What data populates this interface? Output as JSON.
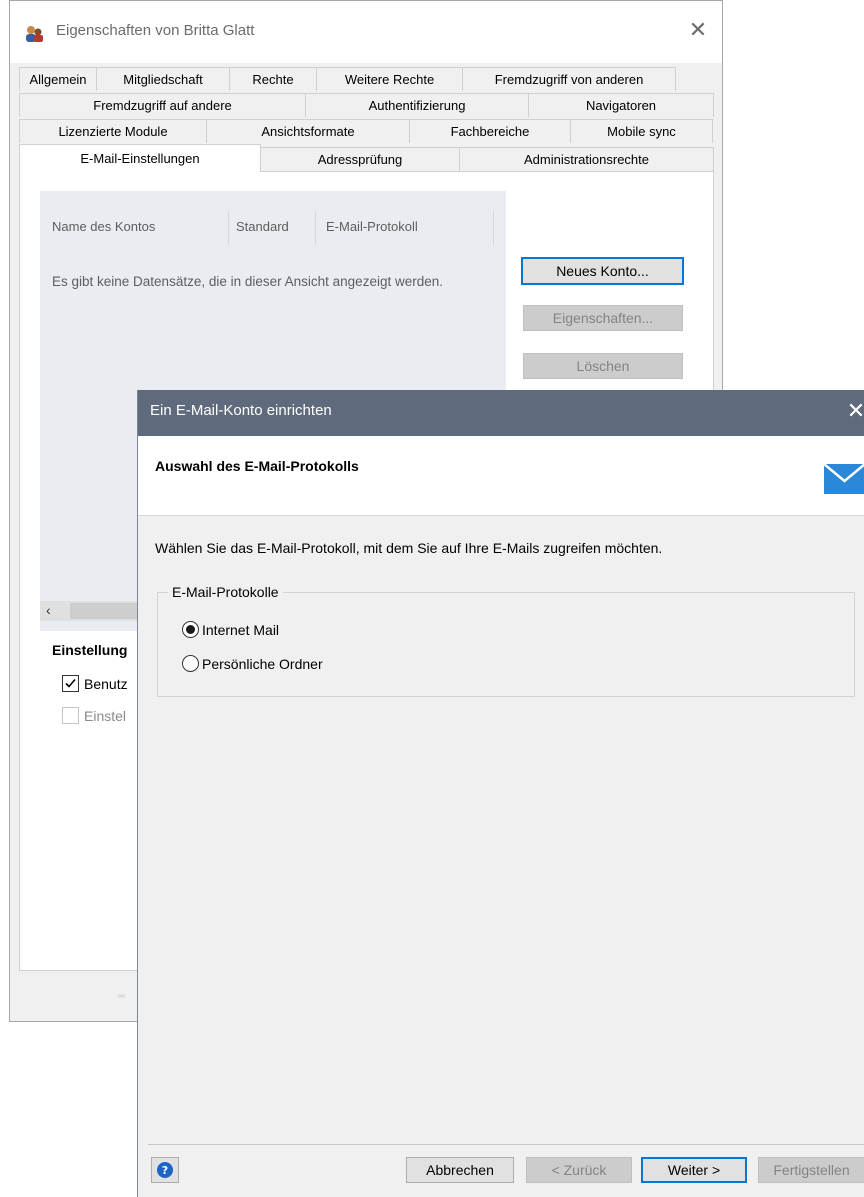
{
  "main_window": {
    "title": "Eigenschaften von Britta Glatt",
    "close_glyph": "✕",
    "tabs_row1": [
      "Allgemein",
      "Mitgliedschaft",
      "Rechte",
      "Weitere Rechte",
      "Fremdzugriff von anderen"
    ],
    "tabs_row2": [
      "Fremdzugriff auf andere",
      "Authentifizierung",
      "Navigatoren"
    ],
    "tabs_row3": [
      "Lizenzierte Module",
      "Ansichtsformate",
      "Fachbereiche",
      "Mobile sync"
    ],
    "tabs_row4": [
      "E-Mail-Einstellungen",
      "Adressprüfung",
      "Administrationsrechte"
    ],
    "active_tab": "E-Mail-Einstellungen",
    "accounts_list": {
      "columns": [
        "Name des Kontos",
        "Standard",
        "E-Mail-Protokoll"
      ],
      "empty_message": "Es gibt keine Datensätze, die in dieser Ansicht angezeigt werden."
    },
    "buttons": {
      "new_account": "Neues Konto...",
      "properties": "Eigenschaften...",
      "delete": "Löschen"
    },
    "settings_label": "Einstellung",
    "checkbox_1_label": "Benutz",
    "checkbox_2_label": "Einstel",
    "scroll_left_glyph": "‹"
  },
  "dialog": {
    "title": "Ein E-Mail-Konto einrichten",
    "close_glyph": "✕",
    "header_title": "Auswahl des E-Mail-Protokolls",
    "description": "Wählen Sie das E-Mail-Protokoll, mit dem Sie auf Ihre E-Mails zugreifen möchten.",
    "group_label": "E-Mail-Protokolle",
    "options": [
      "Internet Mail",
      "Persönliche Ordner"
    ],
    "selected_option": "Internet Mail",
    "help_glyph": "?",
    "buttons": {
      "cancel": "Abbrechen",
      "back": "< Zurück",
      "next": "Weiter >",
      "finish": "Fertigstellen"
    }
  },
  "colors": {
    "dialog_titlebar": "#5f6b7c",
    "default_button_border": "#0078d7",
    "list_background": "#e9edf2",
    "mail_icon": "#2b88d8"
  }
}
